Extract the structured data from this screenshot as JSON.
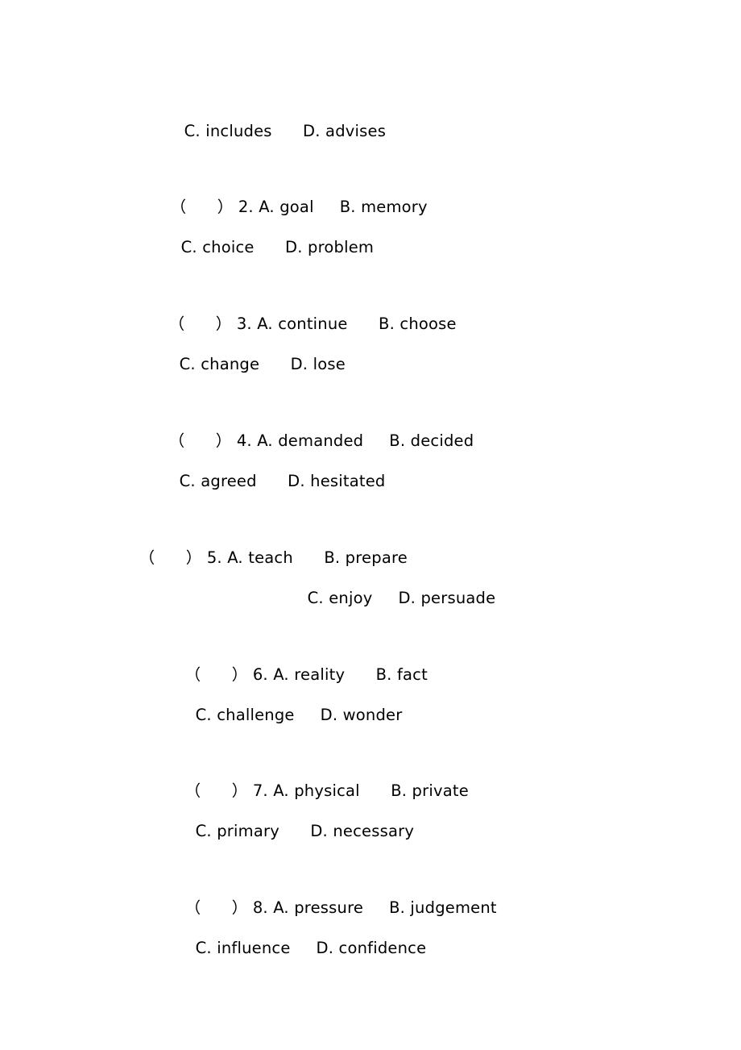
{
  "document": {
    "type": "multiple-choice-worksheet",
    "page_background": "#ffffff",
    "text_color": "#000000",
    "blank_marker": "（      ）"
  },
  "continuation": {
    "option_c": "C. includes",
    "option_d": "D. advises"
  },
  "questions": [
    {
      "blank": "（      ）",
      "number": "2.",
      "option_a": "A. goal",
      "option_b": "B. memory",
      "option_c": "C. choice",
      "option_d": "D. problem"
    },
    {
      "blank": "（      ）",
      "number": "3.",
      "option_a": "A. continue",
      "option_b": "B. choose",
      "option_c": "C. change",
      "option_d": "D. lose"
    },
    {
      "blank": "（      ）",
      "number": "4.",
      "option_a": "A. demanded",
      "option_b": "B. decided",
      "option_c": "C. agreed",
      "option_d": "D. hesitated"
    },
    {
      "blank": "（      ）",
      "number": "5.",
      "option_a": "A. teach",
      "option_b": "B. prepare",
      "option_c": "C. enjoy",
      "option_d": "D. persuade"
    },
    {
      "blank": "（      ）",
      "number": "6.",
      "option_a": "A. reality",
      "option_b": "B. fact",
      "option_c": "C. challenge",
      "option_d": "D. wonder"
    },
    {
      "blank": "（      ）",
      "number": "7.",
      "option_a": "A. physical",
      "option_b": "B. private",
      "option_c": "C. primary",
      "option_d": "D. necessary"
    },
    {
      "blank": "（      ）",
      "number": "8.",
      "option_a": "A. pressure",
      "option_b": "B. judgement",
      "option_c": "C. influence",
      "option_d": "D. confidence"
    }
  ]
}
